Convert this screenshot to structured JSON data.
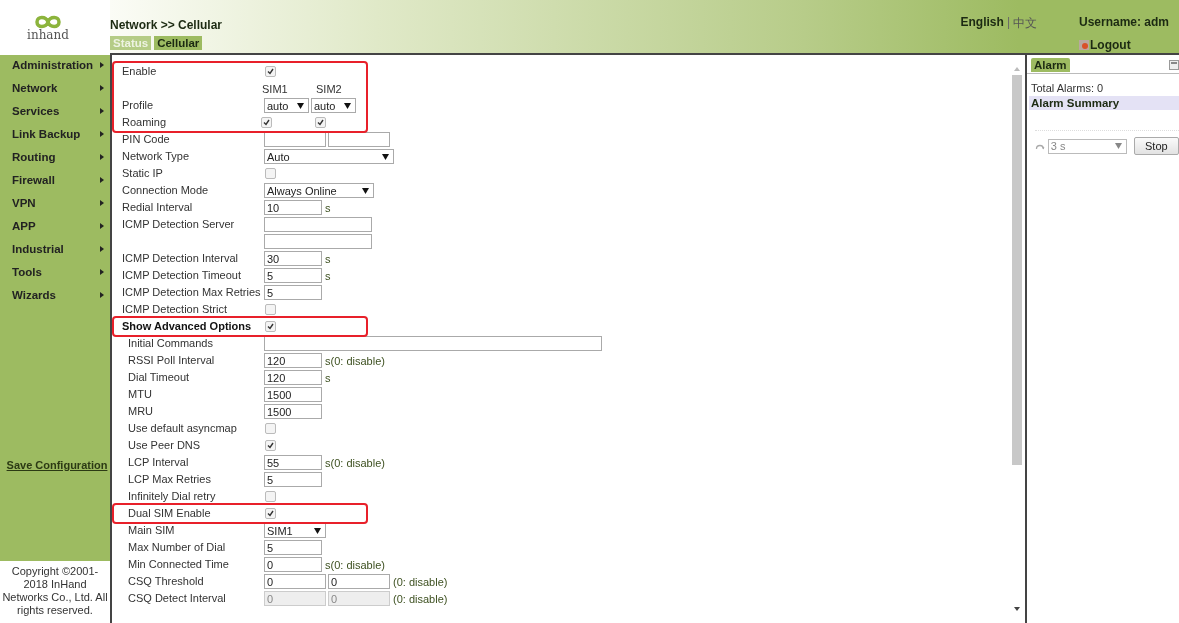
{
  "logo": {
    "text": "inhand"
  },
  "sidebar": {
    "items": [
      {
        "label": "Administration"
      },
      {
        "label": "Network"
      },
      {
        "label": "Services"
      },
      {
        "label": "Link Backup"
      },
      {
        "label": "Routing"
      },
      {
        "label": "Firewall"
      },
      {
        "label": "VPN"
      },
      {
        "label": "APP"
      },
      {
        "label": "Industrial"
      },
      {
        "label": "Tools"
      },
      {
        "label": "Wizards"
      }
    ],
    "save_link": "Save Configuration",
    "copyright": "Copyright ©2001-2018 InHand Networks Co., Ltd. All rights reserved."
  },
  "header": {
    "breadcrumb": "Network >> Cellular",
    "tabs": [
      {
        "label": "Status",
        "selected": false
      },
      {
        "label": "Cellular",
        "selected": true
      }
    ],
    "languages": [
      {
        "label": "English",
        "selected": true
      },
      {
        "label": "中文",
        "selected": false
      }
    ],
    "language_separator": "|",
    "username": "Username: adm",
    "logout": "Logout"
  },
  "form": {
    "groups": [
      {
        "highlighted": true,
        "indented": false,
        "rows": [
          {
            "label": "Enable",
            "controls": [
              {
                "kind": "checkbox",
                "checked": true
              }
            ]
          },
          {
            "controls": [
              {
                "kind": "caption",
                "text": "SIM1"
              },
              {
                "kind": "caption",
                "text": "SIM2"
              }
            ]
          },
          {
            "label": "Profile",
            "controls": [
              {
                "kind": "minidropdown",
                "value": "auto"
              },
              {
                "kind": "minidropdown",
                "value": "auto"
              }
            ]
          },
          {
            "label": "Roaming",
            "controls": [
              {
                "kind": "checkbox",
                "checked": true
              },
              {
                "kind": "checkbox",
                "checked": true
              }
            ]
          }
        ]
      },
      {
        "highlighted": false,
        "indented": false,
        "rows": [
          {
            "label": "PIN Code",
            "controls": [
              {
                "kind": "pairfield"
              },
              {
                "kind": "pairfield"
              }
            ]
          },
          {
            "label": "Network Type",
            "controls": [
              {
                "kind": "widedropdown",
                "value": "Auto"
              }
            ]
          },
          {
            "label": "Static IP",
            "controls": [
              {
                "kind": "checkbox",
                "checked": false
              }
            ]
          },
          {
            "label": "Connection Mode",
            "controls": [
              {
                "kind": "dropdown",
                "value": "Always Online"
              }
            ]
          },
          {
            "label": "Redial Interval",
            "controls": [
              {
                "kind": "field",
                "value": "10"
              },
              {
                "kind": "unit",
                "text": "s"
              }
            ]
          },
          {
            "label": "ICMP Detection Server",
            "controls": [
              {
                "kind": "longfield"
              }
            ]
          },
          {
            "controls": [
              {
                "kind": "longfield"
              }
            ]
          },
          {
            "label": "ICMP Detection Interval",
            "controls": [
              {
                "kind": "field",
                "value": "30"
              },
              {
                "kind": "unit",
                "text": "s"
              }
            ]
          },
          {
            "label": "ICMP Detection Timeout",
            "controls": [
              {
                "kind": "field",
                "value": "5"
              },
              {
                "kind": "unit",
                "text": "s"
              }
            ]
          },
          {
            "label": "ICMP Detection Max Retries",
            "controls": [
              {
                "kind": "field",
                "value": "5"
              }
            ]
          },
          {
            "label": "ICMP Detection Strict",
            "controls": [
              {
                "kind": "checkbox",
                "checked": false
              }
            ]
          }
        ]
      },
      {
        "highlighted": true,
        "indented": false,
        "rows": [
          {
            "label": "Show Advanced Options",
            "emphasized": true,
            "controls": [
              {
                "kind": "checkbox",
                "checked": true
              }
            ]
          }
        ]
      },
      {
        "highlighted": false,
        "indented": true,
        "rows": [
          {
            "label": "Initial Commands",
            "controls": [
              {
                "kind": "widefield"
              }
            ]
          },
          {
            "label": "RSSI Poll Interval",
            "controls": [
              {
                "kind": "field",
                "value": "120"
              },
              {
                "kind": "unit",
                "text": "s(0: disable)"
              }
            ]
          },
          {
            "label": "Dial Timeout",
            "controls": [
              {
                "kind": "field",
                "value": "120"
              },
              {
                "kind": "unit",
                "text": "s"
              }
            ]
          },
          {
            "label": "MTU",
            "controls": [
              {
                "kind": "field",
                "value": "1500"
              }
            ]
          },
          {
            "label": "MRU",
            "controls": [
              {
                "kind": "field",
                "value": "1500"
              }
            ]
          },
          {
            "label": "Use default asyncmap",
            "controls": [
              {
                "kind": "checkbox",
                "checked": false
              }
            ]
          },
          {
            "label": "Use Peer DNS",
            "controls": [
              {
                "kind": "checkbox",
                "checked": true
              }
            ]
          },
          {
            "label": "LCP Interval",
            "controls": [
              {
                "kind": "field",
                "value": "55"
              },
              {
                "kind": "unit",
                "text": "s(0: disable)"
              }
            ]
          },
          {
            "label": "LCP Max Retries",
            "controls": [
              {
                "kind": "field",
                "value": "5"
              }
            ]
          },
          {
            "label": "Infinitely Dial retry",
            "controls": [
              {
                "kind": "checkbox",
                "checked": false
              }
            ]
          }
        ]
      },
      {
        "highlighted": true,
        "indented": true,
        "rows": [
          {
            "label": "Dual SIM Enable",
            "controls": [
              {
                "kind": "checkbox",
                "checked": true
              }
            ]
          }
        ]
      },
      {
        "highlighted": false,
        "indented": true,
        "rows": [
          {
            "label": "Main SIM",
            "controls": [
              {
                "kind": "smalldropdown",
                "value": "SIM1"
              }
            ]
          },
          {
            "label": "Max Number of Dial",
            "controls": [
              {
                "kind": "field",
                "value": "5"
              }
            ]
          },
          {
            "label": "Min Connected Time",
            "controls": [
              {
                "kind": "field",
                "value": "0"
              },
              {
                "kind": "unit",
                "text": "s(0: disable)"
              }
            ]
          },
          {
            "label": "CSQ Threshold",
            "controls": [
              {
                "kind": "pairfield",
                "value": "0"
              },
              {
                "kind": "pairfield",
                "value": "0"
              },
              {
                "kind": "unit",
                "text": "(0: disable)"
              }
            ]
          },
          {
            "label": "CSQ Detect Interval",
            "controls": [
              {
                "kind": "pairfield",
                "value": "0",
                "disabled": true
              },
              {
                "kind": "pairfield",
                "value": "0",
                "disabled": true
              },
              {
                "kind": "unit",
                "text": "(0: disable)"
              }
            ]
          }
        ]
      }
    ]
  },
  "alarm": {
    "tab": "Alarm",
    "total": "Total Alarms: 0",
    "summary_title": "Alarm Summary",
    "refresh_value": "3 s",
    "stop_button": "Stop"
  }
}
